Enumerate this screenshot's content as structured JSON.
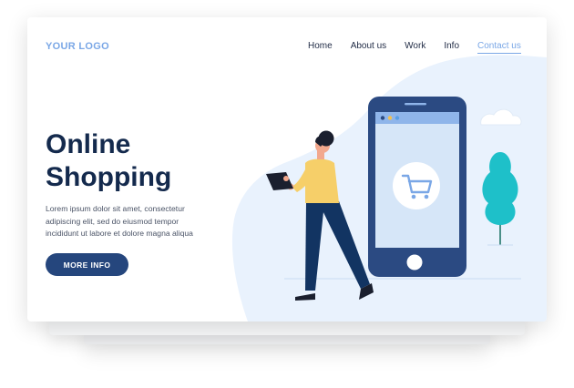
{
  "header": {
    "logo": "YOUR LOGO",
    "nav": [
      {
        "label": "Home",
        "active": false
      },
      {
        "label": "About us",
        "active": false
      },
      {
        "label": "Work",
        "active": false
      },
      {
        "label": "Info",
        "active": false
      },
      {
        "label": "Contact us",
        "active": true
      }
    ]
  },
  "hero": {
    "title_line1": "Online",
    "title_line2": "Shopping",
    "text_lines": [
      "Lorem ipsum dolor sit amet, consectetur",
      "adipiscing elit, sed do eiusmod tempor",
      "incididunt ut labore et dolore magna aliqua"
    ],
    "cta_label": "MORE INFO"
  },
  "illustration": {
    "phone_icon": "shopping-cart-icon",
    "figure": "woman-holding-tablet",
    "tree": "tree-icon",
    "cloud": "cloud-icon"
  },
  "colors": {
    "accent": "#7aa7e6",
    "navy": "#142a4d",
    "button": "#25467d",
    "phone_frame": "#2b4a82",
    "phone_screen": "#d6e6f8",
    "blob": "#e9f2fd",
    "tree": "#1ec0c9"
  }
}
